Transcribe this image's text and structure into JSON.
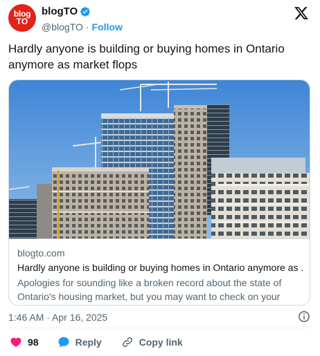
{
  "author": {
    "avatar_line1": "blog",
    "avatar_line2": "TO",
    "display_name": "blogTO",
    "handle": "@blogTO",
    "separator": "·",
    "follow_label": "Follow"
  },
  "tweet": {
    "text": "Hardly anyone is building or buying homes in Ontario anymore as market flops"
  },
  "card": {
    "domain": "blogto.com",
    "title": "Hardly anyone is building or buying homes in Ontario anymore as ...",
    "description": "Apologies for sounding like a broken record about the state of Ontario's housing market, but you may want to check on your realt..."
  },
  "meta": {
    "timestamp": "1:46 AM · Apr 16, 2025"
  },
  "actions": {
    "like_count": "98",
    "reply_label": "Reply",
    "copy_label": "Copy link"
  },
  "colors": {
    "brand_red": "#e2231a",
    "accent_blue": "#1d9bf0",
    "like_pink": "#f91880",
    "secondary_text": "#536471"
  },
  "icons": {
    "verified": "verified-badge-icon",
    "x_logo": "x-logo-icon",
    "info": "info-icon",
    "like": "heart-icon",
    "reply": "speech-bubble-icon",
    "copy": "link-icon"
  }
}
